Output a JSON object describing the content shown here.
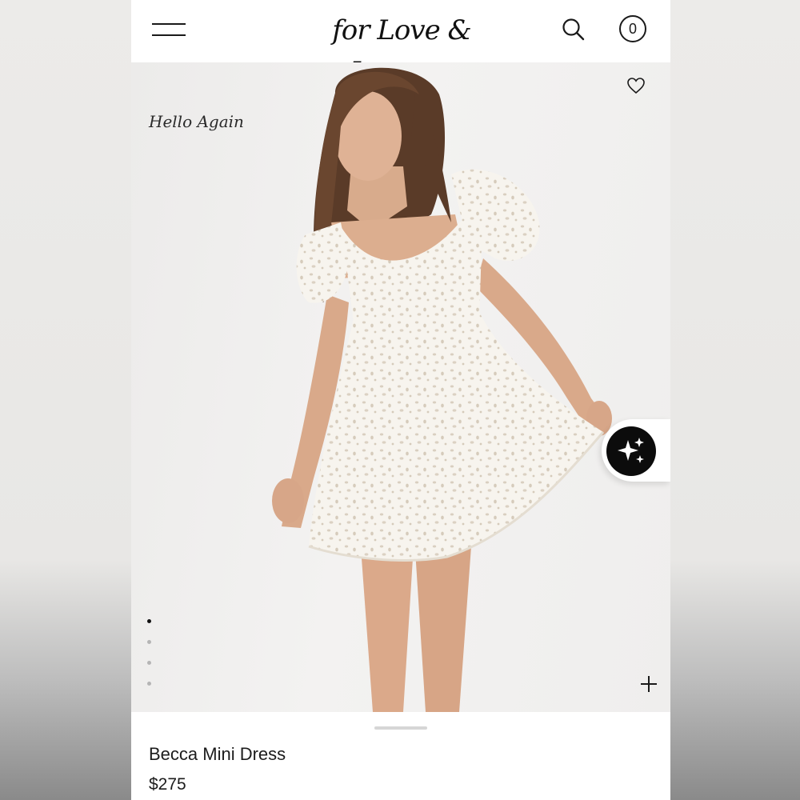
{
  "header": {
    "logo_text": "for Love & Lemons",
    "cart_count": "0",
    "menu_icon": "hamburger-menu-icon",
    "search_icon": "search-icon"
  },
  "hero": {
    "promo_text": "Hello Again",
    "favorite_icon": "heart-icon",
    "zoom_icon": "plus-icon",
    "ai_icon": "sparkles-icon",
    "carousel": {
      "count": 4,
      "active_index": 0
    }
  },
  "product": {
    "name": "Becca Mini Dress",
    "price": "$275"
  },
  "colors": {
    "text": "#1a1a1a",
    "ai_button": "#0c0c0c",
    "background": "#ffffff"
  }
}
